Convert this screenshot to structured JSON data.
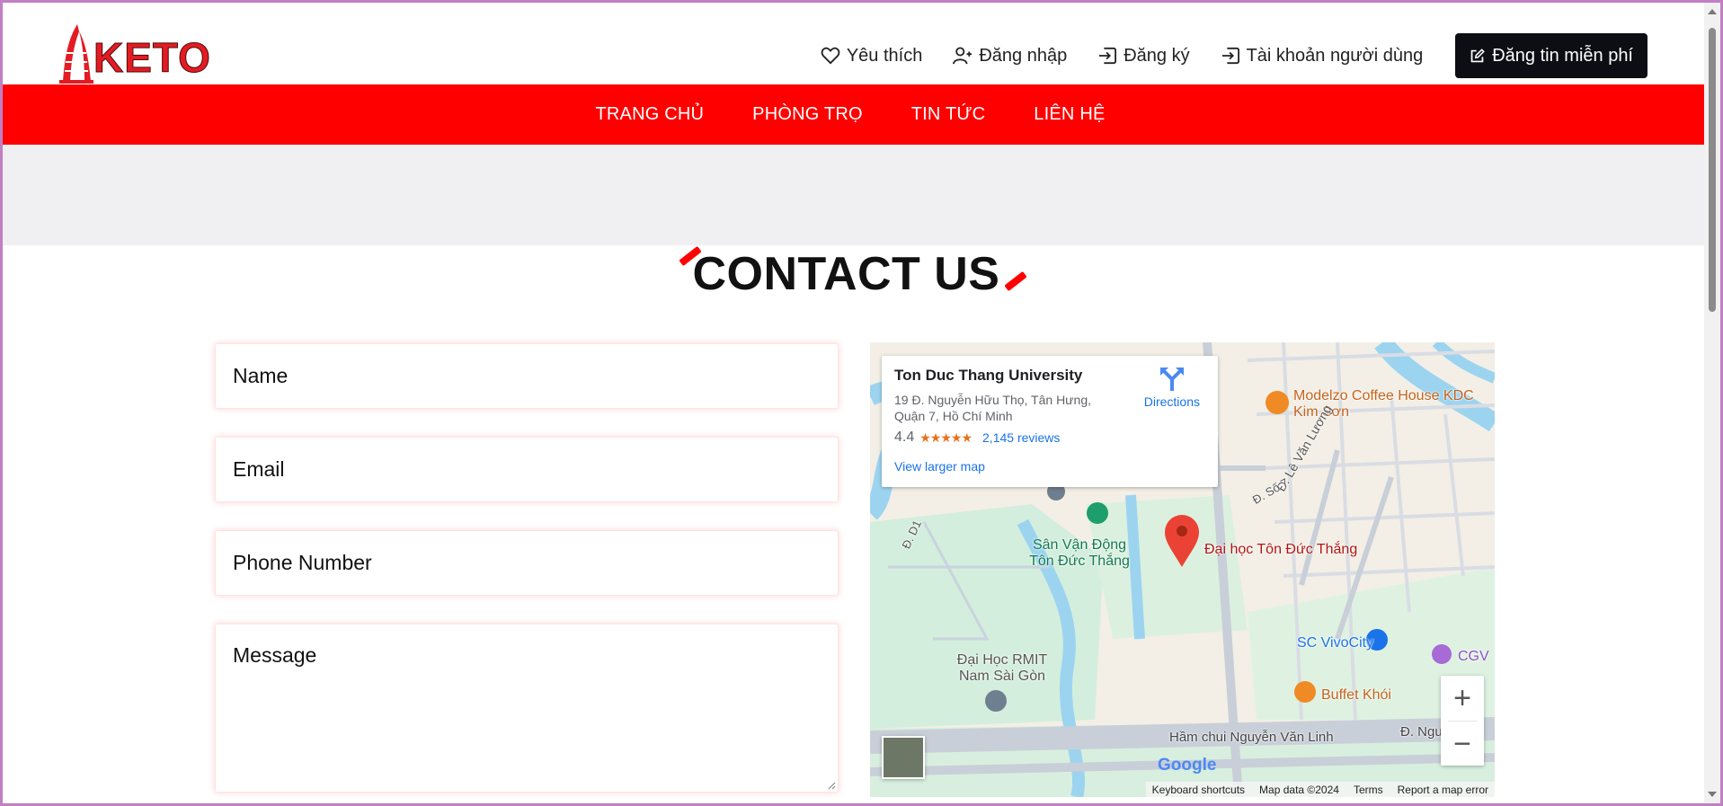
{
  "header": {
    "logo_text": "KETO",
    "links": [
      {
        "label": "Yêu thích",
        "icon": "heart-icon"
      },
      {
        "label": "Đăng nhập",
        "icon": "user-plus-icon"
      },
      {
        "label": "Đăng ký",
        "icon": "sign-in-icon"
      },
      {
        "label": "Tài khoản người dùng",
        "icon": "sign-in-icon"
      }
    ],
    "post_button": "Đăng tin miễn phí"
  },
  "nav": {
    "items": [
      "TRANG CHỦ",
      "PHÒNG TRỌ",
      "TIN TỨC",
      "LIÊN HỆ"
    ]
  },
  "page_title": "CONTACT US",
  "form": {
    "name_placeholder": "Name",
    "email_placeholder": "Email",
    "phone_placeholder": "Phone Number",
    "message_placeholder": "Message"
  },
  "map": {
    "place_name": "Ton Duc Thang University",
    "address": "19 Đ. Nguyễn Hữu Thọ, Tân Hưng, Quận 7, Hồ Chí Minh",
    "rating": "4.4",
    "stars": "★★★★★",
    "reviews": "2,145 reviews",
    "larger_map": "View larger map",
    "directions": "Directions",
    "labels": {
      "cafe": "Modelzo Coffee House KDC Kim Sơn",
      "university": "Đại học Tôn Đức Thắng",
      "stadium": "Sân Vận Động Tôn Đức Thắng",
      "rmit": "Đại Học RMIT Nam Sài Gòn",
      "vivocity": "SC VivoCity",
      "buffet": "Buffet Khói",
      "cgv": "CGV",
      "tunnel": "Hầm chui Nguyễn Văn Linh",
      "road_right": "Đ. Ngu",
      "road_le": "Đ. Lê Văn Lương",
      "road_so7": "Đ. Số 7",
      "road_d1": "Đ. D1"
    },
    "google": "Google",
    "footer": [
      "Keyboard shortcuts",
      "Map data ©2024",
      "Terms",
      "Report a map error"
    ],
    "colors": {
      "accent": "#1a73e8",
      "pin": "#ea4335"
    }
  },
  "colors": {
    "brand_red": "#ff0000",
    "dark": "#0d0d14"
  }
}
